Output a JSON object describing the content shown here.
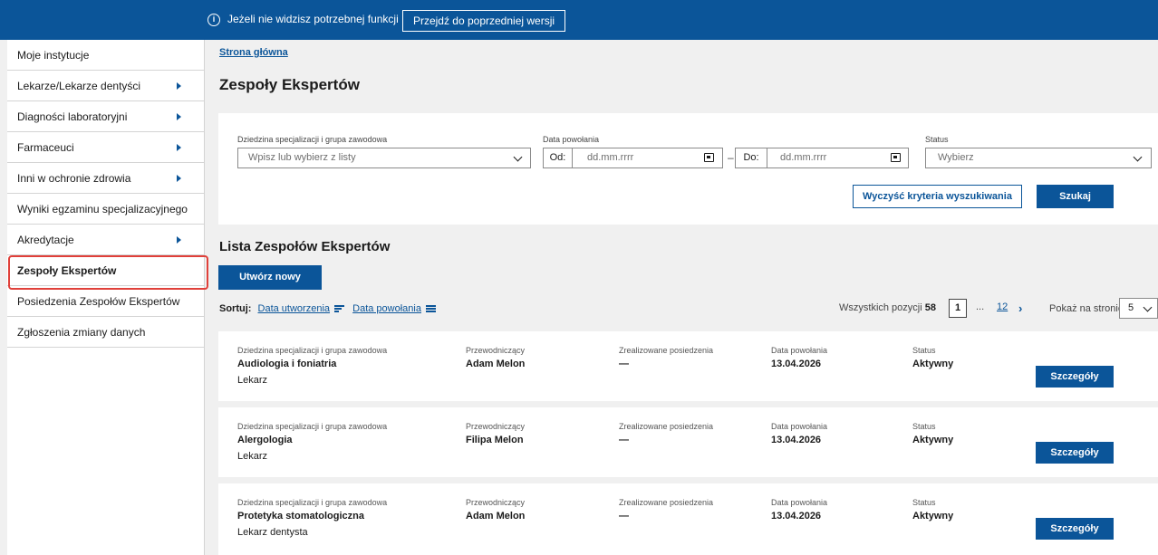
{
  "topbar": {
    "info_icon": "info-icon",
    "info_text": "Jeżeli nie widzisz potrzebnej funkcji",
    "prev_version_button": "Przejdź do poprzedniej wersji"
  },
  "sidebar": {
    "items": [
      {
        "label": "Moje instytucje",
        "has_submenu": false,
        "active": false
      },
      {
        "label": "Lekarze/Lekarze dentyści",
        "has_submenu": true,
        "active": false
      },
      {
        "label": "Diagności laboratoryjni",
        "has_submenu": true,
        "active": false
      },
      {
        "label": "Farmaceuci",
        "has_submenu": true,
        "active": false
      },
      {
        "label": "Inni w ochronie zdrowia",
        "has_submenu": true,
        "active": false
      },
      {
        "label": "Wyniki egzaminu specjalizacyjnego",
        "has_submenu": false,
        "active": false
      },
      {
        "label": "Akredytacje",
        "has_submenu": true,
        "active": false
      },
      {
        "label": "Zespoły Ekspertów",
        "has_submenu": false,
        "active": true
      },
      {
        "label": "Posiedzenia Zespołów Ekspertów",
        "has_submenu": false,
        "active": false
      },
      {
        "label": "Zgłoszenia zmiany danych",
        "has_submenu": false,
        "active": false
      }
    ]
  },
  "breadcrumb": "Strona główna",
  "page_title": "Zespoły Ekspertów",
  "filters": {
    "specialization_label": "Dziedzina specjalizacji i grupa zawodowa",
    "specialization_placeholder": "Wpisz lub wybierz z listy",
    "date_label": "Data powołania",
    "date_from_prefix": "Od:",
    "date_to_prefix": "Do:",
    "date_placeholder": "dd.mm.rrrr",
    "date_separator": "–",
    "status_label": "Status",
    "status_placeholder": "Wybierz",
    "clear_button": "Wyczyść kryteria wyszukiwania",
    "search_button": "Szukaj"
  },
  "list": {
    "title": "Lista Zespołów Ekspertów",
    "create_button": "Utwórz nowy",
    "sort_label": "Sortuj:",
    "sort_created": "Data utworzenia",
    "sort_appointed": "Data powołania",
    "total_label": "Wszystkich pozycji",
    "total_count": "58",
    "current_page": "1",
    "page_ellipsis": "...",
    "last_page": "12",
    "next_icon": "chevron-right-icon",
    "per_page_label": "Pokaż na stronie",
    "per_page_value": "5",
    "column_labels": {
      "specialization": "Dziedzina specjalizacji i grupa zawodowa",
      "chair": "Przewodniczący",
      "meetings": "Zrealizowane posiedzenia",
      "date": "Data powołania",
      "status": "Status"
    },
    "details_button": "Szczegóły",
    "rows": [
      {
        "specialization": "Audiologia i foniatria",
        "group": "Lekarz",
        "chair": "Adam Melon",
        "meetings": "—",
        "date": "13.04.2026",
        "status": "Aktywny"
      },
      {
        "specialization": "Alergologia",
        "group": "Lekarz",
        "chair": "Filipa Melon",
        "meetings": "—",
        "date": "13.04.2026",
        "status": "Aktywny"
      },
      {
        "specialization": "Protetyka stomatologiczna",
        "group": "Lekarz dentysta",
        "chair": "Adam Melon",
        "meetings": "—",
        "date": "13.04.2026",
        "status": "Aktywny"
      }
    ]
  },
  "colors": {
    "primary": "#0b5599",
    "active_outline": "#e0403a",
    "background": "#f0f0f0"
  }
}
